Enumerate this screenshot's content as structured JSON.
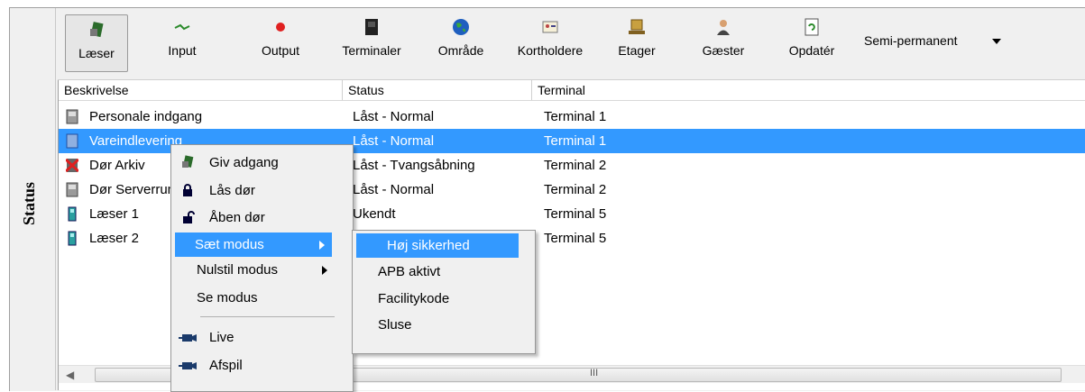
{
  "side_label": "Status",
  "toolbar": {
    "buttons": [
      {
        "label": "Læser",
        "icon": "reader-icon"
      },
      {
        "label": "Input",
        "icon": "input-icon"
      },
      {
        "label": "Output",
        "icon": "output-icon"
      },
      {
        "label": "Terminaler",
        "icon": "terminal-icon"
      },
      {
        "label": "Område",
        "icon": "globe-icon"
      },
      {
        "label": "Kortholdere",
        "icon": "cardholder-icon"
      },
      {
        "label": "Etager",
        "icon": "floor-icon"
      },
      {
        "label": "Gæster",
        "icon": "guest-icon"
      },
      {
        "label": "Opdatér",
        "icon": "refresh-icon"
      }
    ],
    "mode_select": "Semi-permanent"
  },
  "table": {
    "columns": [
      "Beskrivelse",
      "Status",
      "Terminal"
    ],
    "rows": [
      {
        "name": "Personale indgang",
        "status": "Låst - Normal",
        "terminal": "Terminal 1",
        "icon": "door-icon"
      },
      {
        "name": "Vareindlevering",
        "status": "Låst - Normal",
        "terminal": "Terminal 1",
        "icon": "door-icon",
        "selected": true
      },
      {
        "name": "Dør Arkiv",
        "status": "Låst - Tvangsåbning",
        "terminal": "Terminal 2",
        "icon": "alarm-door-icon"
      },
      {
        "name": "Dør Serverrum",
        "status": "Låst - Normal",
        "terminal": "Terminal 2",
        "icon": "door-icon"
      },
      {
        "name": "Læser 1",
        "status": "Ukendt",
        "terminal": "Terminal 5",
        "icon": "reader-device-icon"
      },
      {
        "name": "Læser 2",
        "status": "",
        "terminal": "Terminal 5",
        "icon": "reader-device-icon"
      }
    ]
  },
  "context_menu": {
    "items": [
      {
        "label": "Giv adgang",
        "icon": "grant-access-icon"
      },
      {
        "label": "Lås dør",
        "icon": "lock-icon"
      },
      {
        "label": "Åben dør",
        "icon": "unlock-icon"
      },
      {
        "label": "Sæt modus",
        "submenu": true,
        "highlighted": true
      },
      {
        "label": "Nulstil modus",
        "submenu": true
      },
      {
        "label": "Se modus"
      },
      {
        "label": "Live",
        "icon": "camera-icon"
      },
      {
        "label": "Afspil",
        "icon": "camera-icon"
      }
    ]
  },
  "submenu": {
    "items": [
      "Høj sikkerhed",
      "APB aktivt",
      "Facilitykode",
      "Sluse"
    ]
  },
  "colors": {
    "selection": "#3399ff",
    "background": "#f0f0f0"
  }
}
